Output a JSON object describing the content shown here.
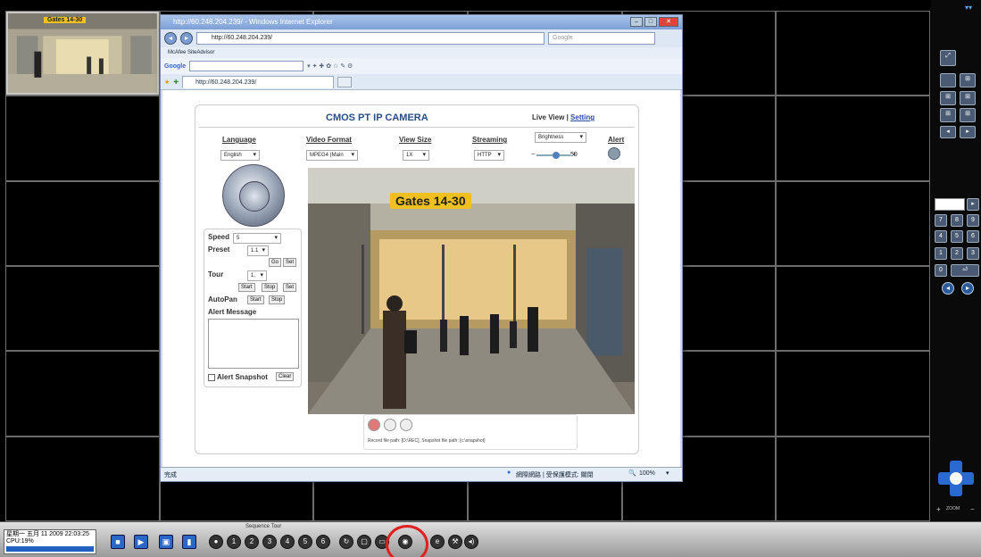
{
  "ie": {
    "title": "http://60.248.204.239/ - Windows Internet Explorer",
    "address": "http://60.248.204.239/",
    "search_placeholder": "Google",
    "toolbar_mcafee": "McAfee SiteAdvisor",
    "google_label": "Google",
    "tab_title": "http://60.248.204.239/",
    "status_left": "完成",
    "status_zone": "網際網路 | 受保護模式: 關閉",
    "status_zoom": "100%"
  },
  "camera": {
    "title": "CMOS PT IP CAMERA",
    "liveview": "Live View",
    "separator": "|",
    "setting": "Setting",
    "options": {
      "language_label": "Language",
      "language_value": "English",
      "video_format_label": "Video Format",
      "video_format_value": "MPEG4 (Main",
      "view_size_label": "View Size",
      "view_size_value": "1X",
      "streaming_label": "Streaming",
      "streaming_value": "HTTP",
      "brightness_value": "Brightness",
      "brightness_level": "50",
      "alert_label": "Alert"
    },
    "controls": {
      "speed_label": "Speed",
      "speed_value": "5",
      "preset_label": "Preset",
      "preset_value": "1.1",
      "go": "Go",
      "set": "Set",
      "tour_label": "Tour",
      "tour_value": "1.",
      "start": "Start",
      "stop": "Stop",
      "tour_set": "Set",
      "autopan_label": "AutoPan",
      "autopan_start": "Start",
      "autopan_stop": "Stop",
      "alert_message": "Alert Message",
      "alert_snapshot": "Alert Snapshot",
      "clear": "Clear"
    },
    "video_sign": "Gates 14-30",
    "record_path": "Record file path: [D:\\REC], Snapshot file path: [c:\\snapshot]"
  },
  "thumbnail": {
    "sign": "Gates 14-30"
  },
  "bottom": {
    "date": "星期一 五月 11 2009 22:03:25",
    "cpu": "CPU:19%",
    "sequence_tour": "Sequence Tour"
  },
  "right_panel": {
    "zoom_label": "ZOOM"
  }
}
